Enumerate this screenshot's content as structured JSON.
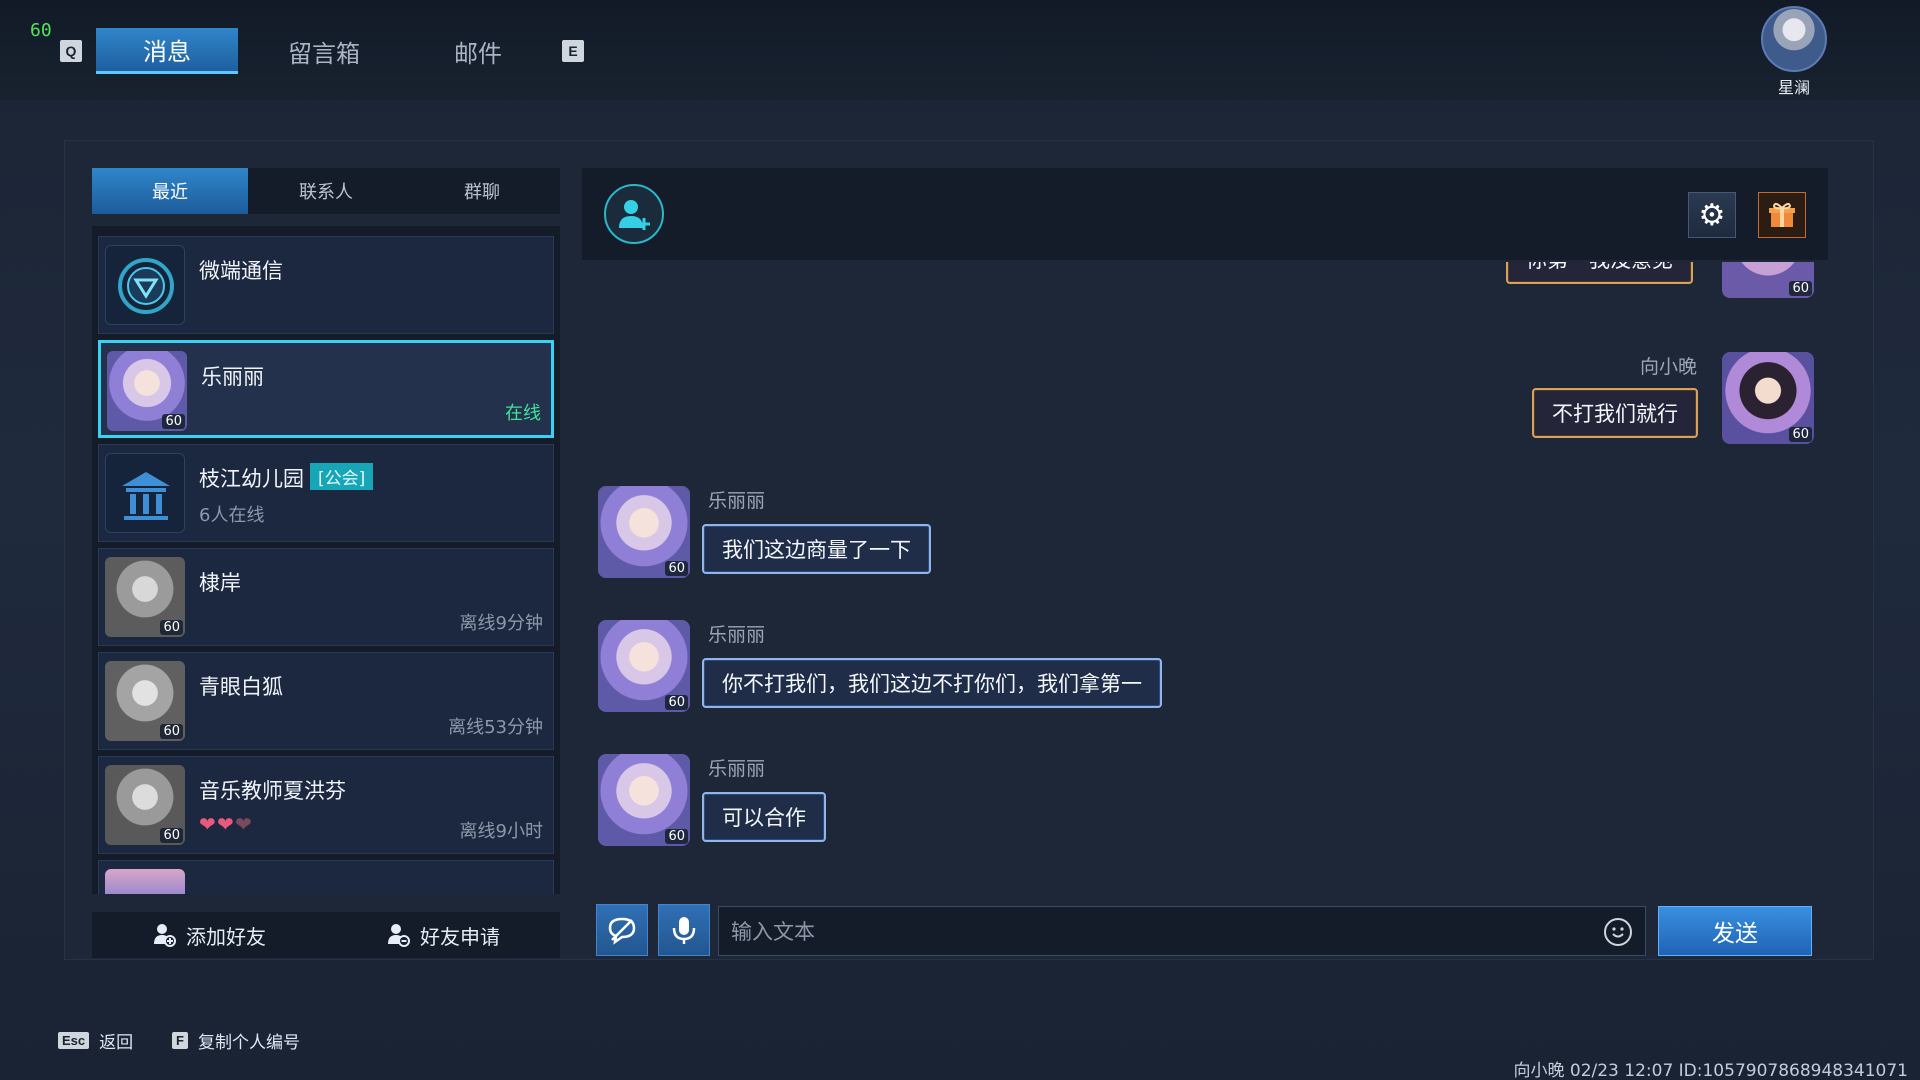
{
  "hud": {
    "fps": "60"
  },
  "top_tabs": {
    "left_key": "Q",
    "right_key": "E",
    "items": [
      {
        "label": "消息"
      },
      {
        "label": "留言箱"
      },
      {
        "label": "邮件"
      }
    ]
  },
  "profile": {
    "name": "星澜"
  },
  "left_tabs": [
    {
      "label": "最近"
    },
    {
      "label": "联系人"
    },
    {
      "label": "群聊"
    }
  ],
  "conversations": [
    {
      "name": "微端通信",
      "sub": "",
      "status": "",
      "level": ""
    },
    {
      "name": "乐丽丽",
      "sub": "",
      "status": "在线",
      "level": "60"
    },
    {
      "name": "枝江幼儿园",
      "tag": "[公会]",
      "sub": "6人在线",
      "status": "",
      "level": ""
    },
    {
      "name": "棣岸",
      "sub": "",
      "status": "离线9分钟",
      "level": "60"
    },
    {
      "name": "青眼白狐",
      "sub": "",
      "status": "离线53分钟",
      "level": "60"
    },
    {
      "name": "音乐教师夏洪芬",
      "sub": "",
      "status": "离线9小时",
      "level": "60"
    }
  ],
  "left_actions": {
    "add_friend": "添加好友",
    "friend_request": "好友申请"
  },
  "messages": [
    {
      "sender": "",
      "text": "你第一我没意见",
      "mine": true,
      "level": "60"
    },
    {
      "sender": "向小晚",
      "text": "不打我们就行",
      "mine": true,
      "level": "60"
    },
    {
      "sender": "乐丽丽",
      "text": "我们这边商量了一下",
      "mine": false,
      "level": "60"
    },
    {
      "sender": "乐丽丽",
      "text": "你不打我们，我们这边不打你们，我们拿第一",
      "mine": false,
      "level": "60"
    },
    {
      "sender": "乐丽丽",
      "text": "可以合作",
      "mine": false,
      "level": "60"
    }
  ],
  "input": {
    "placeholder": "输入文本",
    "send": "发送"
  },
  "footer": {
    "esc_key": "Esc",
    "esc_label": "返回",
    "f_key": "F",
    "f_label": "复制个人编号",
    "info": "向小晚  02/23 12:07  ID:1057907868948341071"
  },
  "colors": {
    "accent": "#2f86c9",
    "online": "#3fe39a",
    "active_border": "#38d2f2"
  }
}
